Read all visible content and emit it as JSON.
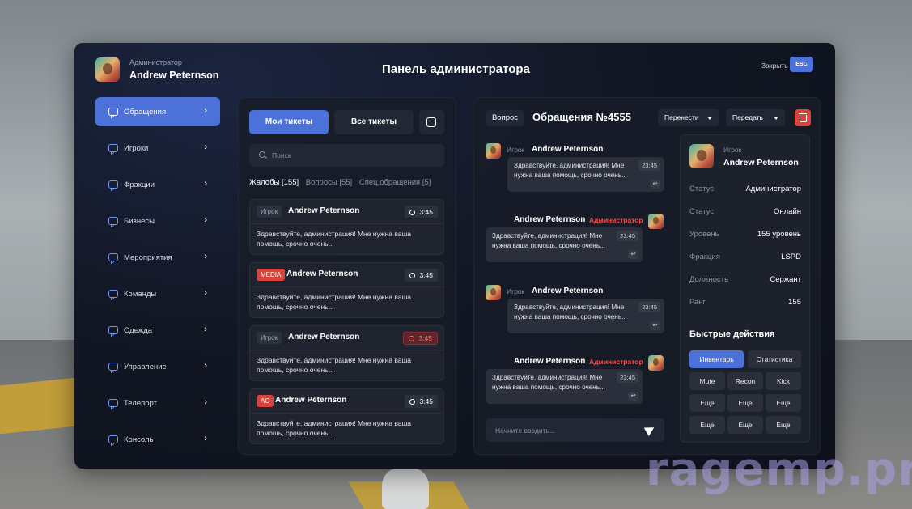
{
  "header": {
    "role": "Администратор",
    "name": "Andrew Peternson",
    "title": "Панель администратора",
    "close_label": "Закрыть",
    "esc_label": "ESC"
  },
  "sidebar": {
    "items": [
      {
        "label": "Обращения",
        "active": true
      },
      {
        "label": "Игроки"
      },
      {
        "label": "Фракции"
      },
      {
        "label": "Бизнесы"
      },
      {
        "label": "Мероприятия"
      },
      {
        "label": "Команды"
      },
      {
        "label": "Одежда"
      },
      {
        "label": "Управление"
      },
      {
        "label": "Телепорт"
      },
      {
        "label": "Консоль"
      }
    ]
  },
  "tickets": {
    "my_tickets": "Мои тикеты",
    "all_tickets": "Все тикеты",
    "search_placeholder": "Поиск",
    "filters": [
      "Жалобы [155]",
      "Вопросы [55]",
      "Спец.обращения [5]"
    ],
    "list": [
      {
        "tag": "Игрок",
        "tag_style": "grey",
        "name": "Andrew Peternson",
        "time": "3:45",
        "alert": false,
        "text": "Здравствуйте, администрация! Мне нужна ваша помощь, срочно очень..."
      },
      {
        "tag": "MEDIA",
        "tag_style": "red",
        "name": "Andrew Peternson",
        "time": "3:45",
        "alert": false,
        "text": "Здравствуйте, администрация! Мне нужна ваша помощь, срочно очень..."
      },
      {
        "tag": "Игрок",
        "tag_style": "grey",
        "name": "Andrew Peternson",
        "time": "3:45",
        "alert": true,
        "text": "Здравствуйте, администрация! Мне нужна ваша помощь, срочно очень..."
      },
      {
        "tag": "AC",
        "tag_style": "red",
        "name": "Andrew Peternson",
        "time": "3:45",
        "alert": false,
        "text": "Здравствуйте, администрация! Мне нужна ваша помощь, срочно очень..."
      }
    ]
  },
  "chat": {
    "type_badge": "Вопрос",
    "title": "Обращения №4555",
    "move_label": "Перенести",
    "transfer_label": "Передать",
    "composer_placeholder": "Начните вводить...",
    "messages": [
      {
        "side": "left",
        "role": "Игрок",
        "name": "Andrew Peternson",
        "time": "23:45",
        "text": "Здравствуйте, администрация! Мне нужна ваша помощь, срочно очень..."
      },
      {
        "side": "right",
        "role": "Администратор",
        "name": "Andrew Peternson",
        "time": "23:45",
        "text": "Здравствуйте, администрация! Мне нужна ваша помощь, срочно очень..."
      },
      {
        "side": "left",
        "role": "Игрок",
        "name": "Andrew Peternson",
        "time": "23:45",
        "text": "Здравствуйте, администрация! Мне нужна ваша помощь, срочно очень..."
      },
      {
        "side": "right",
        "role": "Администратор",
        "name": "Andrew Peternson",
        "time": "23:45",
        "text": "Здравствуйте, администрация! Мне нужна ваша помощь, срочно очень..."
      }
    ]
  },
  "profile": {
    "role": "Игрок",
    "name": "Andrew Peternson",
    "rows": [
      {
        "key": "Статус",
        "value": "Администратор"
      },
      {
        "key": "Статус",
        "value": "Онлайн"
      },
      {
        "key": "Уровень",
        "value": "155 уровень"
      },
      {
        "key": "Фракция",
        "value": "LSPD"
      },
      {
        "key": "Должность",
        "value": "Сержант"
      },
      {
        "key": "Ранг",
        "value": "155"
      }
    ],
    "quick_actions_title": "Быстрые действия",
    "quick_actions": [
      {
        "label": "Инвентарь",
        "primary": true
      },
      {
        "label": "Статистика"
      },
      {
        "label": "Mute"
      },
      {
        "label": "Recon"
      },
      {
        "label": "Kick"
      },
      {
        "label": "Еще"
      },
      {
        "label": "Еще"
      },
      {
        "label": "Еще"
      },
      {
        "label": "Еще"
      },
      {
        "label": "Еще"
      },
      {
        "label": "Еще"
      }
    ]
  },
  "watermark": "ragemp.pro",
  "colors": {
    "accent": "#4c72d9",
    "danger": "#d9433b",
    "admin_text": "#ff4c4c"
  }
}
